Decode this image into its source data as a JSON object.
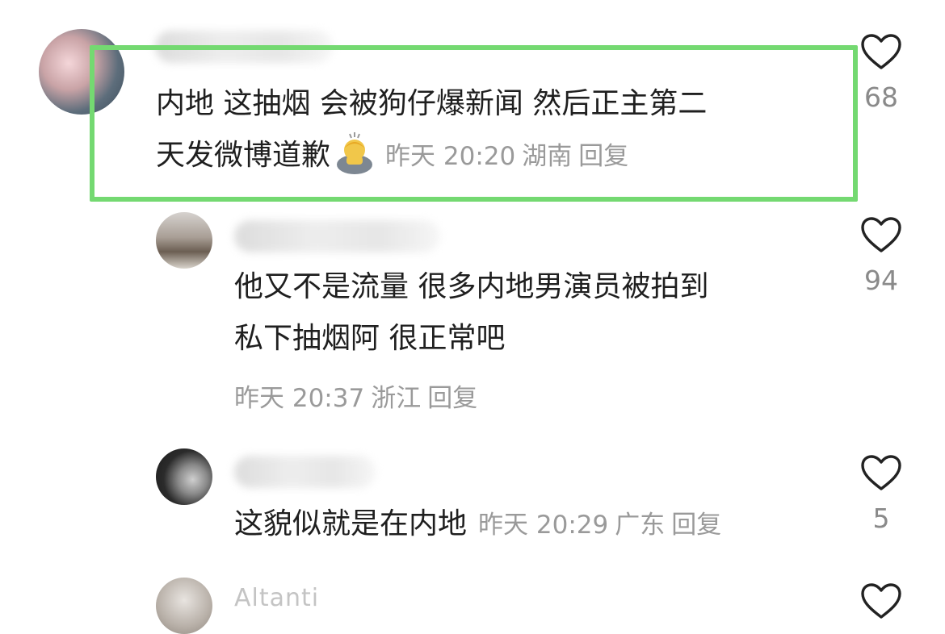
{
  "comments": [
    {
      "text_line1": "内地 这抽烟 会被狗仔爆新闻 然后正主第二",
      "text_line2": "天发微博道歉",
      "emoji": "man-bowing-icon",
      "time": "昨天 20:20",
      "location": "湖南",
      "reply": "回复",
      "likes": "68"
    },
    {
      "text_line1": "他又不是流量 很多内地男演员被拍到",
      "text_line2": "私下抽烟阿 很正常吧",
      "time": "昨天 20:37",
      "location": "浙江",
      "reply": "回复",
      "likes": "94"
    },
    {
      "text_line1": "这貌似就是在内地",
      "time": "昨天 20:29",
      "location": "广东",
      "reply": "回复",
      "likes": "5"
    },
    {
      "username": "Altanti"
    }
  ],
  "colors": {
    "highlight": "#74d971",
    "meta": "#9a9a9a",
    "text": "#1f1f1f"
  }
}
